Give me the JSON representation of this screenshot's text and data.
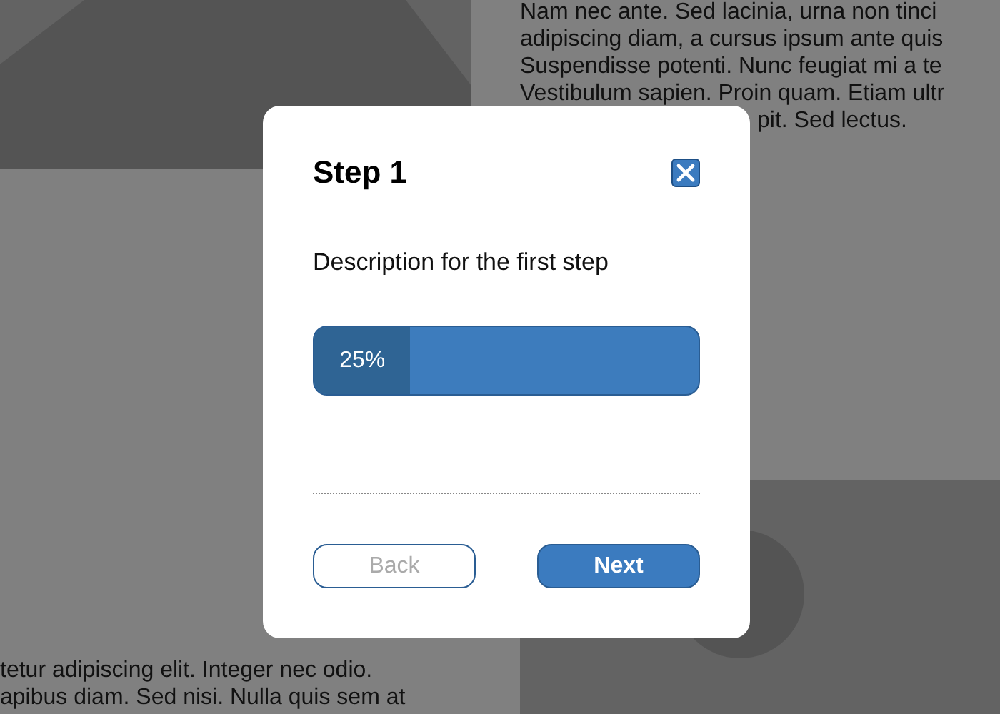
{
  "page": {
    "text_top_right": [
      "Nam nec ante. Sed lacinia, urna non tinci",
      "adipiscing diam, a cursus ipsum ante quis",
      "Suspendisse potenti. Nunc feugiat mi a te",
      "Vestibulum sapien. Proin quam. Etiam ultr",
      "pit. Sed lectus."
    ],
    "text_bottom_left": [
      "tetur adipiscing elit. Integer nec odio.",
      "apibus diam. Sed nisi. Nulla quis sem at"
    ]
  },
  "dialog": {
    "title": "Step 1",
    "description": "Description for the first step",
    "progress": {
      "level": 0.25,
      "label": "25%"
    },
    "buttons": [
      {
        "label": "Back",
        "kind": "secondary",
        "disabled": true
      },
      {
        "label": "Next",
        "kind": "primary",
        "disabled": false
      }
    ]
  }
}
